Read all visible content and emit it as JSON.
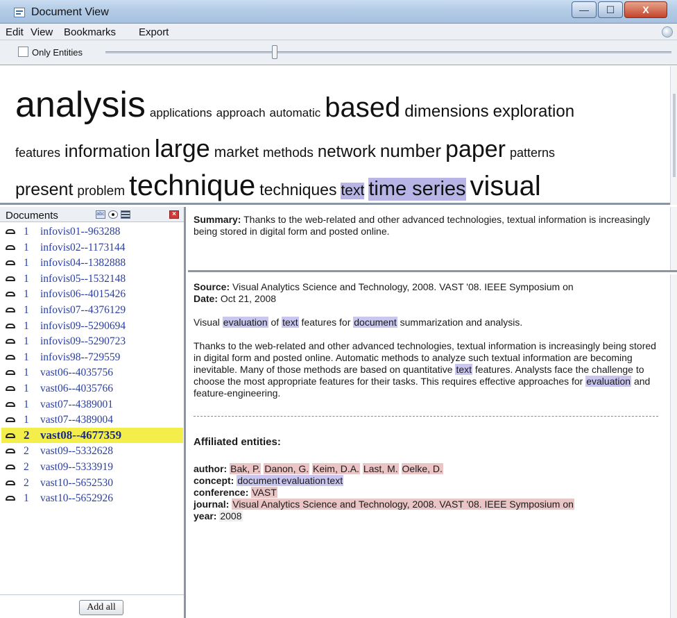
{
  "window": {
    "title": "Document View",
    "controls": {
      "minimize": "—",
      "maximize": "☐",
      "close": "X"
    }
  },
  "menu": {
    "edit": "Edit",
    "view": "View",
    "bookmarks": "Bookmarks",
    "export": "Export"
  },
  "toolbar": {
    "only_entities_label": "Only Entities",
    "only_entities_checked": false
  },
  "cloud": {
    "line1": [
      {
        "word": "analysis",
        "size": 52,
        "hl": false
      },
      {
        "word": "applications",
        "size": 17,
        "hl": false
      },
      {
        "word": "approach",
        "size": 17,
        "hl": false
      },
      {
        "word": "automatic",
        "size": 17,
        "hl": false
      },
      {
        "word": "based",
        "size": 40,
        "hl": false
      },
      {
        "word": "dimensions",
        "size": 24,
        "hl": false
      },
      {
        "word": "exploration",
        "size": 24,
        "hl": false
      }
    ],
    "line2": [
      {
        "word": "features",
        "size": 18,
        "hl": false
      },
      {
        "word": "information",
        "size": 25,
        "hl": false
      },
      {
        "word": "large",
        "size": 36,
        "hl": false
      },
      {
        "word": "market",
        "size": 21,
        "hl": false
      },
      {
        "word": "methods",
        "size": 19,
        "hl": false
      },
      {
        "word": "network",
        "size": 24,
        "hl": false
      },
      {
        "word": "number",
        "size": 26,
        "hl": false
      },
      {
        "word": "paper",
        "size": 34,
        "hl": false
      },
      {
        "word": "patterns",
        "size": 18,
        "hl": false
      }
    ],
    "line3": [
      {
        "word": "present",
        "size": 25,
        "hl": false
      },
      {
        "word": "problem",
        "size": 19,
        "hl": false
      },
      {
        "word": "technique",
        "size": 42,
        "hl": false
      },
      {
        "word": "techniques",
        "size": 23,
        "hl": false
      },
      {
        "word": "text",
        "size": 21,
        "hl": true
      },
      {
        "word": "time series",
        "size": 29,
        "hl": true
      },
      {
        "word": "visual",
        "size": 40,
        "hl": false
      }
    ]
  },
  "documents": {
    "header": "Documents",
    "add_all_label": "Add all",
    "items": [
      {
        "count": "1",
        "name": "infovis01--963288"
      },
      {
        "count": "1",
        "name": "infovis02--1173144"
      },
      {
        "count": "1",
        "name": "infovis04--1382888"
      },
      {
        "count": "1",
        "name": "infovis05--1532148"
      },
      {
        "count": "1",
        "name": "infovis06--4015426"
      },
      {
        "count": "1",
        "name": "infovis07--4376129"
      },
      {
        "count": "1",
        "name": "infovis09--5290694"
      },
      {
        "count": "1",
        "name": "infovis09--5290723"
      },
      {
        "count": "1",
        "name": "infovis98--729559"
      },
      {
        "count": "1",
        "name": "vast06--4035756"
      },
      {
        "count": "1",
        "name": "vast06--4035766"
      },
      {
        "count": "1",
        "name": "vast07--4389001"
      },
      {
        "count": "1",
        "name": "vast07--4389004"
      },
      {
        "count": "2",
        "name": "vast08--4677359",
        "selected": true
      },
      {
        "count": "2",
        "name": "vast09--5332628"
      },
      {
        "count": "2",
        "name": "vast09--5333919"
      },
      {
        "count": "2",
        "name": "vast10--5652530"
      },
      {
        "count": "1",
        "name": "vast10--5652926"
      }
    ]
  },
  "summary": {
    "label": "Summary:",
    "text": " Thanks to the web-related and other advanced technologies, textual information is increasingly being stored in digital form and posted online."
  },
  "detail": {
    "source_label": "Source:",
    "source_text": " Visual Analytics Science and Technology, 2008. VAST '08. IEEE Symposium on",
    "date_label": "Date:",
    "date_text": " Oct 21, 2008",
    "title_parts": {
      "p1": "Visual ",
      "h1": "evaluation",
      "p2": " of ",
      "h2": "text",
      "p3": " features for ",
      "h3": "document",
      "p4": " summarization and analysis."
    },
    "abstract_parts": {
      "p1": "Thanks to the web-related and other advanced technologies, textual information is increasingly being stored in digital form and posted online. Automatic methods to analyze such textual information are becoming inevitable. Many of those methods are based on quantitative ",
      "h1": "text",
      "p2": " features. Analysts face the challenge to choose the most appropriate features for their tasks. This requires effective approaches for ",
      "h2": "evaluation",
      "p3": " and feature-engineering."
    },
    "affiliated_title": "Affiliated entities:",
    "author_label": "author:",
    "authors": [
      "Bak, P.",
      "Danon, G.",
      "Keim, D.A.",
      "Last, M.",
      "Oelke, D."
    ],
    "concept_label": "concept:",
    "concepts": [
      "document",
      "evaluation",
      "text"
    ],
    "conference_label": "conference:",
    "conference": "VAST",
    "journal_label": "journal:",
    "journal": "Visual Analytics Science and Technology, 2008. VAST '08. IEEE Symposium on",
    "year_label": "year:",
    "year": "2008"
  },
  "colors": {
    "selected_row": "#f3ee49",
    "entity_red": "#ebc5c5",
    "entity_purple": "#c9c6ef",
    "cloud_highlight": "#b8b5e6"
  }
}
